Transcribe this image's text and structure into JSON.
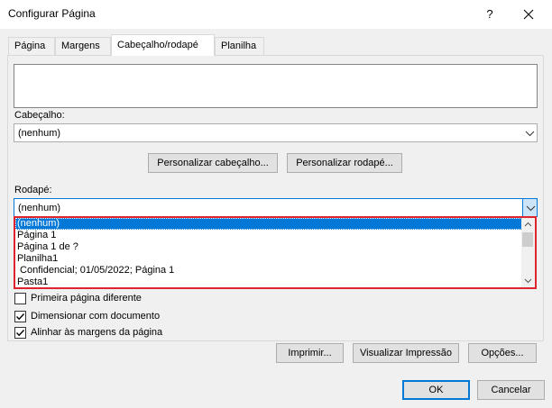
{
  "window": {
    "title": "Configurar Página",
    "help": "?"
  },
  "tabs": [
    {
      "label": "Página"
    },
    {
      "label": "Margens"
    },
    {
      "label": "Cabeçalho/rodapé"
    },
    {
      "label": "Planilha"
    }
  ],
  "header": {
    "label": "Cabeçalho:",
    "value": "(nenhum)",
    "customize_label": "Personalizar cabeçalho..."
  },
  "footer": {
    "label": "Rodapé:",
    "value": "(nenhum)",
    "customize_label": "Personalizar rodapé...",
    "options": [
      "(nenhum)",
      "Página 1",
      "Página 1 de ?",
      "Planilha1",
      " Confidencial; 01/05/2022; Página 1",
      "Pasta1"
    ]
  },
  "checkboxes": [
    {
      "label": "Primeira página diferente",
      "checked": false
    },
    {
      "label": "Dimensionar com documento",
      "checked": true
    },
    {
      "label": "Alinhar às margens da página",
      "checked": true
    }
  ],
  "buttons": {
    "print": "Imprimir...",
    "preview": "Visualizar Impressão",
    "options": "Opções...",
    "ok": "OK",
    "cancel": "Cancelar"
  },
  "colors": {
    "accent": "#0078d7",
    "highlight_border": "#e0242e"
  }
}
